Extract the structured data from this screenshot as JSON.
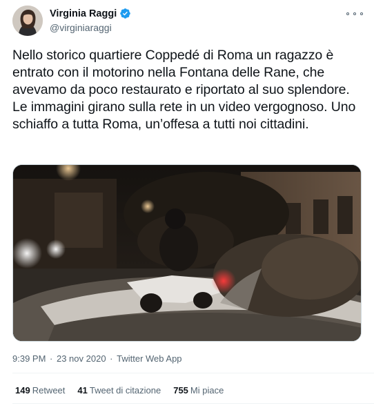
{
  "author": {
    "display_name": "Virginia Raggi",
    "handle": "@virginiaraggi",
    "verified": true,
    "verified_color": "#1d9bf0"
  },
  "icons": {
    "more": "more-options-icon",
    "verified": "verified-badge-icon"
  },
  "tweet": {
    "text": "Nello storico quartiere Coppedé di Roma un ragazzo è entrato con il motorino nella Fontana delle Rane, che avevamo da poco restaurato e riportato al suo splendore. Le immagini girano sulla rete in un video vergognoso. Uno schiaffo a tutta Roma, un’offesa a tutti noi cittadini."
  },
  "meta": {
    "time": "9:39 PM",
    "date": "23 nov 2020",
    "source": "Twitter Web App"
  },
  "stats": {
    "retweets_count": "149",
    "retweets_label": "Retweet",
    "quotes_count": "41",
    "quotes_label": "Tweet di citazione",
    "likes_count": "755",
    "likes_label": "Mi piace"
  }
}
